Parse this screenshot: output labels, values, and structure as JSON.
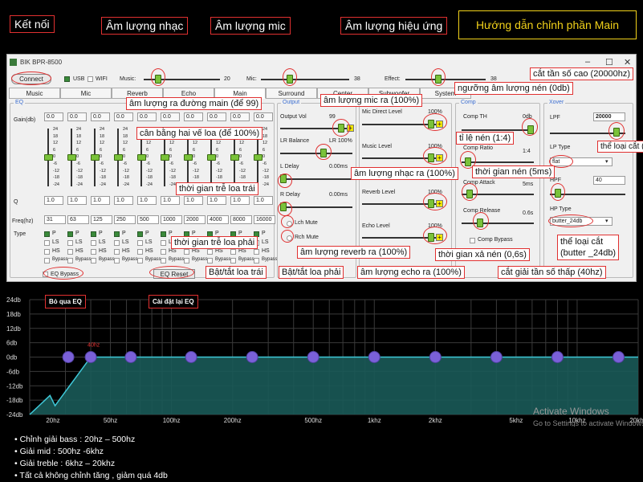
{
  "top_labels": {
    "connect": "Kết nối",
    "music_vol": "Âm lượng nhạc",
    "mic_vol": "Âm lượng mic",
    "effect_vol": "Âm lượng hiệu ứng",
    "guide": "Hướng dẫn chỉnh phần Main"
  },
  "window": {
    "title": "BIK BPR-8500",
    "connect": "Connect",
    "usb": "USB",
    "wifi": "WIFI",
    "music_label": "Music:",
    "music_val": "20",
    "mic_label": "Mic:",
    "mic_val": "38",
    "effect_label": "Effect:",
    "effect_val": "38",
    "tabs": [
      "Music",
      "Mic",
      "Reverb",
      "Echo",
      "Main",
      "Surround",
      "Center",
      "Subwoofer",
      "System"
    ]
  },
  "eq": {
    "group": "EQ",
    "gain_label": "Gain(db)",
    "gains": [
      "0.0",
      "0.0",
      "0.0",
      "0.0",
      "0.0",
      "0.0",
      "0.0",
      "0.0",
      "0.0",
      "0.0"
    ],
    "scale": [
      "24",
      "18",
      "12",
      "6",
      "0",
      "-6",
      "-12",
      "-18",
      "-24"
    ],
    "q_label": "Q",
    "qs": [
      "1.0",
      "1.0",
      "1.0",
      "1.0",
      "1.0",
      "1.0",
      "1.0",
      "1.0",
      "1.0",
      "1.0"
    ],
    "freq_label": "Freq(hz)",
    "freqs": [
      "31",
      "63",
      "125",
      "250",
      "500",
      "1000",
      "2000",
      "4000",
      "8000",
      "16000"
    ],
    "type_label": "Type",
    "type_opts": [
      "P",
      "LS",
      "HS",
      "Bypass"
    ],
    "bypass": "EQ Bypass",
    "reset": "EQ Reset"
  },
  "output": {
    "group": "Output",
    "output_vol": "Output Vol",
    "output_val": "99",
    "lr_balance": "LR Balance",
    "lr_val": "LR 100%",
    "l_delay": "L Delay",
    "l_delay_val": "0.00ms",
    "r_delay": "R Delay",
    "r_delay_val": "0.00ms",
    "lch_mute": "Lch Mute",
    "rch_mute": "Rch Mute"
  },
  "levels": {
    "mic_direct": "Mic Direct Level",
    "music_level": "Music Level",
    "reverb_level": "Reverb Level",
    "echo_level": "Echo Level",
    "pct": "100%"
  },
  "comp": {
    "group": "Comp",
    "th": "Comp TH",
    "th_val": "0db",
    "ratio": "Comp Ratio",
    "ratio_val": "1:4",
    "attack": "Comp Attack",
    "attack_val": "5ms",
    "release": "Comp Release",
    "release_val": "0.6s",
    "bypass": "Comp Bypass"
  },
  "xover": {
    "group": "Xover",
    "lpf": "LPF",
    "lpf_val": "20000",
    "lp_type": "LP Type",
    "lp_type_val": "flat",
    "hpf": "HPF",
    "hpf_val": "40",
    "hp_type": "HP Type",
    "hp_type_val": "butter_24db"
  },
  "callouts": {
    "main_out": "âm lượng ra đường main (để 99)",
    "mic_out": "âm lượng mic ra (100%)",
    "balance": "cân bằng hai vế loa (để 100%)",
    "delay_left": "thời gian trễ loa trái",
    "delay_right": "thời gian trễ loa phải",
    "mute_left": "Bật/tắt loa trái",
    "mute_right": "Bật/tắt loa phải",
    "music_out": "âm lượng nhạc ra (100%)",
    "reverb_out": "âm lượng reverb ra (100%)",
    "echo_out": "âm lượng echo ra (100%)",
    "threshold": "ngưỡng âm lượng nén (0db)",
    "ratio": "tỉ lệ nén (1:4)",
    "attack": "thời gian nén (5ms)",
    "release": "thời gian xả nén (0,6s)",
    "lpf_cut": "cắt tần số cao (20000hz)",
    "lp_type": "thể loại cắt (flat)",
    "hp_type_1": "thể loại cắt",
    "hp_type_2": "(butter _24db)",
    "hpf_cut": "cắt giải tần số thấp (40hz)",
    "eq_bypass": "Bỏ qua EQ",
    "eq_reset": "Cài đặt lại EQ"
  },
  "chart": {
    "y_ticks": [
      "24db",
      "18db",
      "12db",
      "6db",
      "0db",
      "-6db",
      "-12db",
      "-18db",
      "-24db"
    ],
    "x_ticks": [
      "20hz",
      "50hz",
      "100hz",
      "200hz",
      "500hz",
      "1khz",
      "2khz",
      "5khz",
      "10khz",
      "20khz"
    ],
    "marker_label": "40hz",
    "watermark_1": "Activate Windows",
    "watermark_2": "Go to Settings to activate Windows."
  },
  "chart_data": {
    "type": "line",
    "title": "",
    "xlabel": "",
    "ylabel": "",
    "x_scale": "log",
    "x": [
      20,
      40,
      100,
      200,
      500,
      1000,
      2000,
      5000,
      10000,
      20000
    ],
    "series": [
      {
        "values": [
          -24,
          0,
          0,
          0,
          0,
          0,
          0,
          0,
          0,
          0
        ]
      }
    ],
    "ylim": [
      -24,
      24
    ],
    "grid": true,
    "colors": {
      "fill": "#1a5a58",
      "line": "#3fc8d8",
      "point": "#7a60d8"
    }
  },
  "notes": [
    "Chỉnh giải bass : 20hz – 500hz",
    "Giải mid : 500hz -6khz",
    "Giải treble : 6khz – 20khz",
    "Tất cả không chỉnh tăng , giảm quá 4db"
  ]
}
